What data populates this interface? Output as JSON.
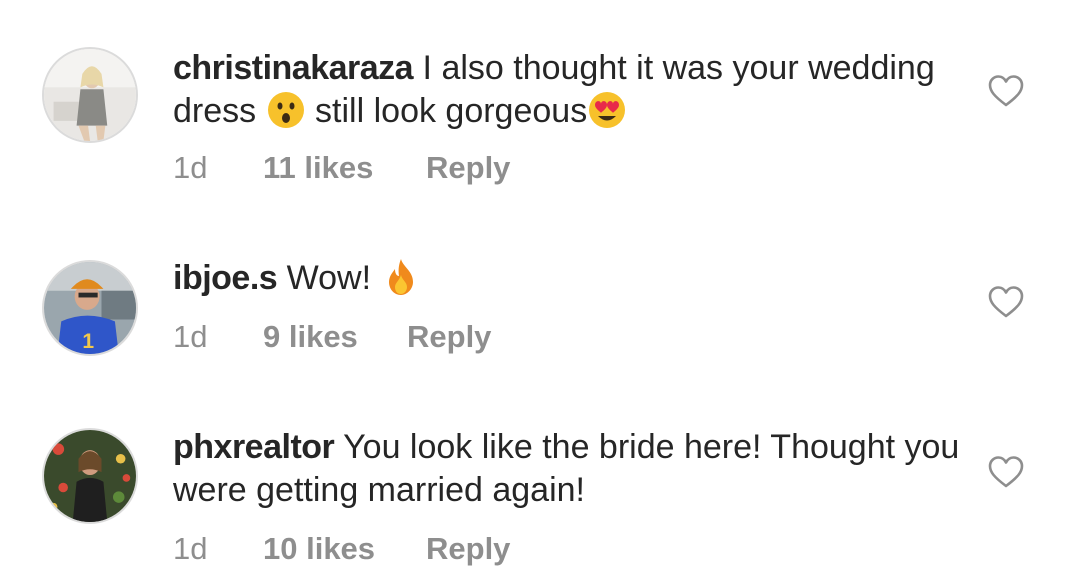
{
  "comments": [
    {
      "username": "christinakaraza",
      "text_part1": "I also thought it was your wedding dress",
      "emoji1": "astonished-face-emoji",
      "text_part2": "still look gorgeous",
      "emoji2": "heart-eyes-emoji",
      "time": "1d",
      "likes": "11 likes",
      "reply": "Reply"
    },
    {
      "username": "ibjoe.s",
      "text_part1": "Wow!",
      "emoji1": "fire-emoji",
      "time": "1d",
      "likes": "9 likes",
      "reply": "Reply"
    },
    {
      "username": "phxrealtor",
      "text_part1": "You look like the bride here! Thought you were getting married again!",
      "time": "1d",
      "likes": "10 likes",
      "reply": "Reply"
    }
  ],
  "colors": {
    "text": "#262626",
    "meta": "#8e8e8e",
    "background": "#ffffff"
  }
}
